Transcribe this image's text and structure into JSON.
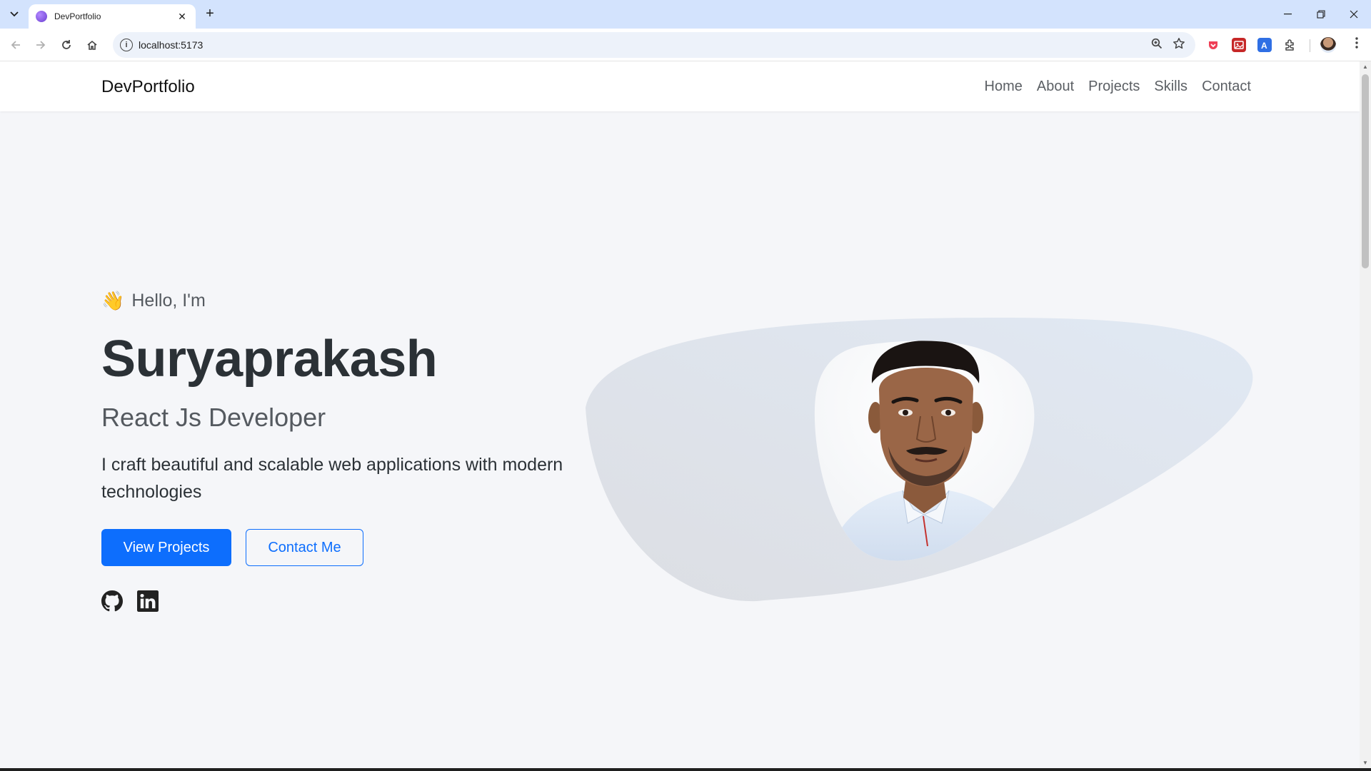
{
  "browser": {
    "tab_title": "DevPortfolio",
    "url": "localhost:5173",
    "icons": [
      "tab-list-icon",
      "close-icon",
      "new-tab-icon",
      "minimize-icon",
      "restore-icon",
      "close-window-icon",
      "back-icon",
      "forward-icon",
      "reload-icon",
      "home-icon",
      "site-info-icon",
      "zoom-icon",
      "bookmark-star-icon",
      "extensions-icon",
      "menu-icon"
    ]
  },
  "site": {
    "brand": "DevPortfolio",
    "nav": [
      "Home",
      "About",
      "Projects",
      "Skills",
      "Contact"
    ]
  },
  "hero": {
    "wave_emoji": "👋",
    "greeting": "Hello, I'm",
    "name": "Suryaprakash",
    "role": "React Js Developer",
    "description": "I craft beautiful and scalable web applications with modern technologies",
    "primary_button": "View Projects",
    "secondary_button": "Contact Me",
    "social": [
      "github-icon",
      "linkedin-icon"
    ]
  },
  "colors": {
    "accent": "#0d6efd",
    "tabbar": "#d3e3fd",
    "page_bg": "#f5f6f9",
    "heading": "#2b3136"
  }
}
